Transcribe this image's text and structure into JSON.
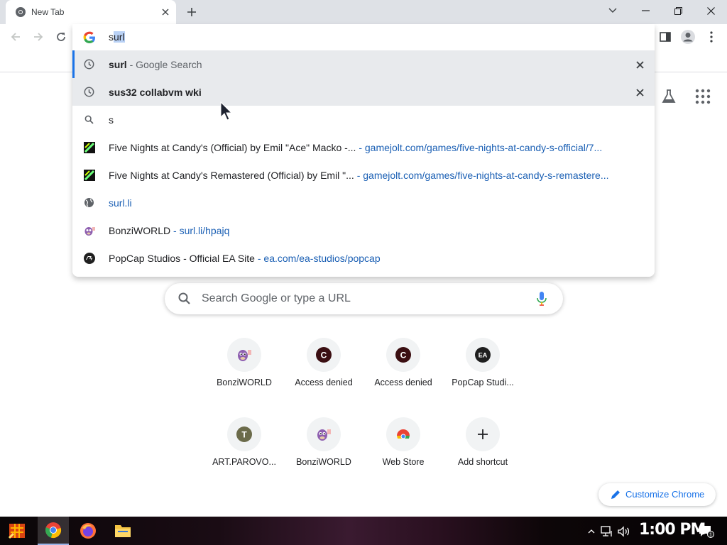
{
  "browser": {
    "tab": {
      "title": "New Tab"
    },
    "omnibox": {
      "typed_prefix": "s",
      "selected_completion": "url"
    },
    "suggestions": [
      {
        "type": "history",
        "bold": "surl",
        "rest": " - Google Search",
        "url": "",
        "removable": true,
        "highlighted": true
      },
      {
        "type": "history",
        "bold": "sus32 collabvm wki",
        "rest": "",
        "url": "",
        "removable": true,
        "highlighted": true
      },
      {
        "type": "search",
        "bold": "",
        "rest": "s",
        "url": "",
        "removable": false,
        "highlighted": false
      },
      {
        "type": "gamejolt",
        "bold": "",
        "rest": "Five Nights at Candy's (Official) by Emil \"Ace\" Macko -...",
        "url": " - gamejolt.com/games/five-nights-at-candy-s-official/7...",
        "removable": false,
        "highlighted": false
      },
      {
        "type": "gamejolt",
        "bold": "",
        "rest": "Five Nights at Candy's Remastered (Official) by Emil \"...",
        "url": " - gamejolt.com/games/five-nights-at-candy-s-remastere...",
        "removable": false,
        "highlighted": false
      },
      {
        "type": "globe",
        "bold": "",
        "rest": "",
        "url": "surl.li",
        "removable": false,
        "highlighted": false
      },
      {
        "type": "bonzi",
        "bold": "",
        "rest": "BonziWORLD",
        "url": " - surl.li/hpajq",
        "removable": false,
        "highlighted": false
      },
      {
        "type": "ea",
        "bold": "",
        "rest": "PopCap Studios - Official EA Site",
        "url": " - ea.com/ea-studios/popcap",
        "removable": false,
        "highlighted": false
      }
    ]
  },
  "ntp": {
    "search_placeholder": "Search Google or type a URL",
    "shortcuts": [
      {
        "label": "BonziWORLD",
        "icon": "bonzi",
        "letter": ""
      },
      {
        "label": "Access denied",
        "icon": "letter-dark",
        "letter": "C"
      },
      {
        "label": "Access denied",
        "icon": "letter-dark",
        "letter": "C"
      },
      {
        "label": "PopCap Studi...",
        "icon": "ea",
        "letter": "EA"
      },
      {
        "label": "ART.PAROVO...",
        "icon": "letter-olive",
        "letter": "T"
      },
      {
        "label": "BonziWORLD",
        "icon": "bonzi",
        "letter": ""
      },
      {
        "label": "Web Store",
        "icon": "webstore",
        "letter": ""
      },
      {
        "label": "Add shortcut",
        "icon": "plus",
        "letter": ""
      }
    ],
    "customize_label": "Customize Chrome"
  },
  "taskbar": {
    "clock": "1:00 PM"
  },
  "colors": {
    "accent": "#1a73e8",
    "url": "#1a5fb4",
    "highlight_row": "#e8eaed",
    "tabstrip": "#dee1e6"
  }
}
